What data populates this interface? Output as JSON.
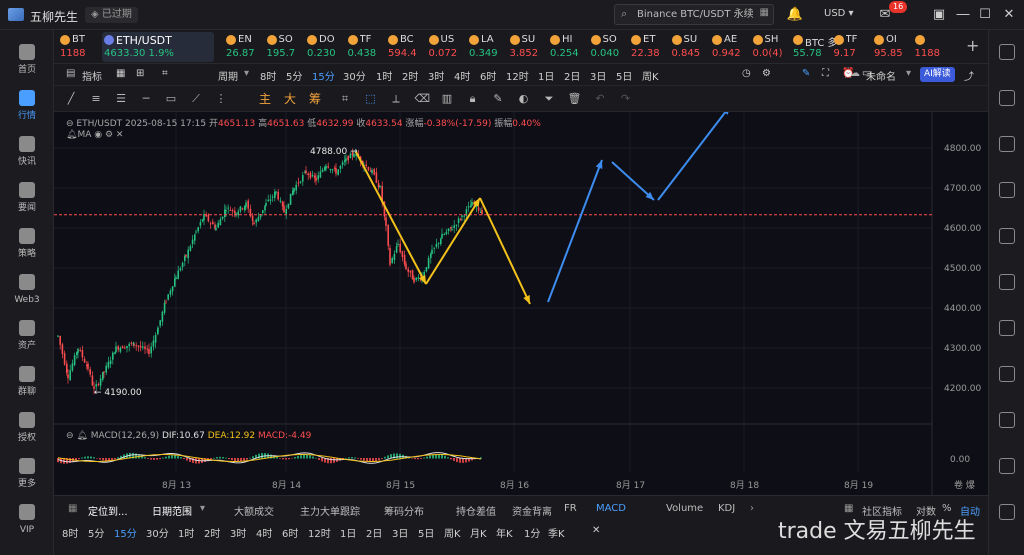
{
  "titlebar": {
    "app_name": "五柳先生",
    "expired": "已过期",
    "search_placeholder": "Binance BTC/USDT 永续",
    "currency": "USD",
    "mail_badge": "16",
    "icons": [
      "bell-icon",
      "mail-icon",
      "minimize-icon",
      "maximize-icon",
      "close-icon"
    ]
  },
  "leftnav": [
    {
      "label": "首页",
      "icon": "home-icon"
    },
    {
      "label": "行情",
      "icon": "market-icon",
      "active": true
    },
    {
      "label": "快讯",
      "icon": "news-icon"
    },
    {
      "label": "要闻",
      "icon": "headline-icon"
    },
    {
      "label": "策略",
      "icon": "strategy-icon"
    },
    {
      "label": "Web3",
      "icon": "web3-icon"
    },
    {
      "label": "资产",
      "icon": "asset-icon"
    },
    {
      "label": "群聊",
      "icon": "chat-icon"
    },
    {
      "label": "授权",
      "icon": "auth-icon"
    },
    {
      "label": "更多",
      "icon": "more-icon"
    },
    {
      "label": "VIP",
      "icon": "vip-icon"
    }
  ],
  "tickers": [
    {
      "name": "BT",
      "price": "1188",
      "dir": "dn"
    },
    {
      "name": "ETH/USDT",
      "price": "4633.30 1.9%",
      "dir": "up",
      "active": true
    },
    {
      "name": "EN",
      "price": "26.87",
      "dir": "up"
    },
    {
      "name": "SO",
      "price": "195.7",
      "dir": "up"
    },
    {
      "name": "DO",
      "price": "0.230",
      "dir": "up"
    },
    {
      "name": "TF",
      "price": "0.438",
      "dir": "up"
    },
    {
      "name": "BC",
      "price": "594.4",
      "dir": "dn"
    },
    {
      "name": "US",
      "price": "0.072",
      "dir": "dn"
    },
    {
      "name": "LA",
      "price": "0.349",
      "dir": "up"
    },
    {
      "name": "SU",
      "price": "3.852",
      "dir": "dn"
    },
    {
      "name": "HI",
      "price": "0.254",
      "dir": "up"
    },
    {
      "name": "SO",
      "price": "0.040",
      "dir": "up"
    },
    {
      "name": "ET",
      "price": "22.38",
      "dir": "dn"
    },
    {
      "name": "SU",
      "price": "0.845",
      "dir": "dn"
    },
    {
      "name": "AE",
      "price": "0.942",
      "dir": "dn"
    },
    {
      "name": "SH",
      "price": "0.0(4)",
      "dir": "dn"
    },
    {
      "name": "BTC 多",
      "price": "55.78",
      "dir": "up"
    },
    {
      "name": "TF",
      "price": "9.17",
      "dir": "dn"
    },
    {
      "name": "OI",
      "price": "95.85",
      "dir": "dn"
    },
    {
      "name": "",
      "price": "1188",
      "dir": "dn"
    }
  ],
  "toolbar1": {
    "indicator": "指标",
    "period": "周期",
    "timeframes": [
      "8时",
      "5分",
      "15分",
      "30分",
      "1时",
      "2时",
      "3时",
      "4时",
      "6时",
      "12时",
      "1日",
      "2日",
      "3日",
      "5日",
      "周K"
    ],
    "selected": "15分",
    "unnamed": "未命名",
    "ai": "AI解读"
  },
  "toolbar2": {
    "cn_tools": [
      "主",
      "大",
      "筹"
    ]
  },
  "chart": {
    "symbol": "ETH/USDT",
    "date": "2025-08-15 17:15",
    "open_label": "开",
    "open": "4651.13",
    "high_label": "高",
    "high": "4651.63",
    "low_label": "低",
    "low": "4632.99",
    "close_label": "收",
    "close": "4633.54",
    "chg_label": "涨幅",
    "chg": "-0.38%(-17.59)",
    "amp_label": "振幅",
    "amp": "0.40%",
    "ma": "MA",
    "peak_label": "4788.00",
    "trough_label": "4190.00",
    "y_ticks": [
      "4800.00",
      "4700.00",
      "4600.00",
      "4500.00",
      "4400.00",
      "4300.00",
      "4200.00"
    ],
    "macd_zero": "0.00",
    "x_ticks": [
      "8月 13",
      "8月 14",
      "8月 15",
      "8月 16",
      "8月 17",
      "8月 18",
      "8月 19"
    ],
    "macd": {
      "name": "MACD(12,26,9)",
      "dif_label": "DIF:10.67",
      "dea_label": "DEA:12.92",
      "macd_label": "MACD:-4.49"
    },
    "colors": {
      "up": "#26c281",
      "down": "#ff4d4f",
      "yellow_arrow": "#f2c21b",
      "blue_arrow": "#3d8df0",
      "price_line": "#ff4d4f"
    }
  },
  "chart_data": {
    "type": "candlestick",
    "series": [
      {
        "name": "ETH/USDT",
        "x": [
          "8月 13",
          "8月 14",
          "8月 15"
        ],
        "high": 4788.0,
        "low": 4190.0,
        "last": 4633.54
      }
    ],
    "ylim": [
      4150,
      4850
    ],
    "macd": {
      "dif": 10.67,
      "dea": 12.92,
      "macd": -4.49
    }
  },
  "bottombar": {
    "locate": "定位到...",
    "date_range": "日期范围",
    "tabs": [
      "大额成交",
      "主力大单跟踪",
      "筹码分布",
      "持仓差值",
      "资金背离",
      "FR",
      "MACD",
      "Volume",
      "KDJ"
    ],
    "selected": "MACD",
    "community": "社区指标",
    "log": "对数",
    "pct": "%",
    "auto": "自动"
  },
  "bottombar2": {
    "timeframes": [
      "8时",
      "5分",
      "15分",
      "30分",
      "1时",
      "2时",
      "3时",
      "4时",
      "6时",
      "12时",
      "1日",
      "2日",
      "3日",
      "5日",
      "周K",
      "月K",
      "年K",
      "1分",
      "季K"
    ],
    "selected": "15分"
  },
  "watermark": "trade 文易五柳先生"
}
